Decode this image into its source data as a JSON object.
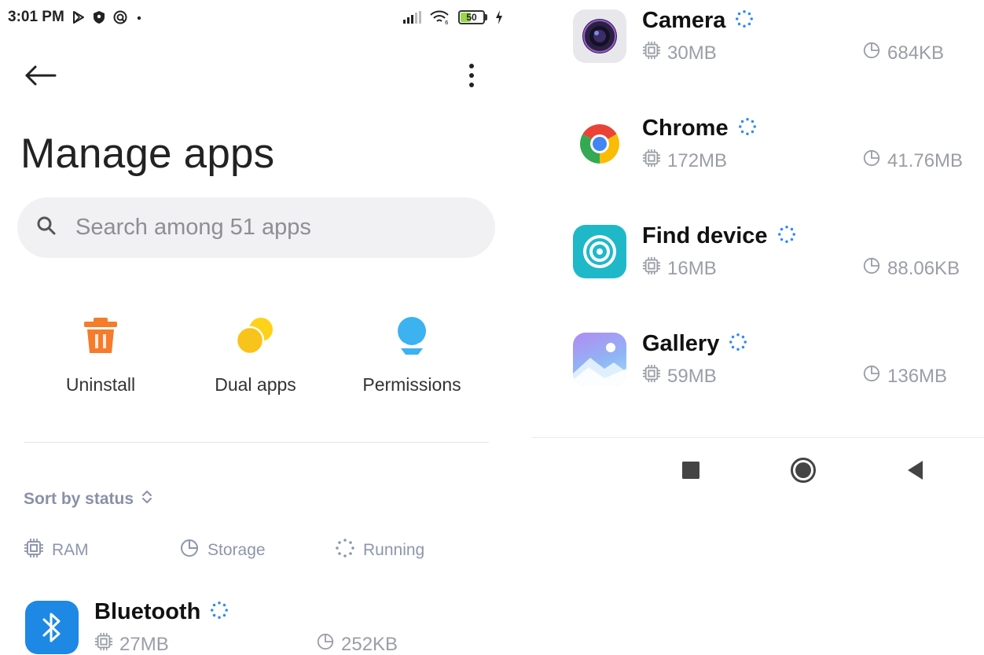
{
  "status_bar": {
    "time": "3:01 PM",
    "icons": [
      "play-store-icon",
      "shield-icon",
      "vpn-icon",
      "dot-icon"
    ],
    "right_icons": [
      "signal-icon",
      "wifi-icon",
      "charging-icon"
    ],
    "battery_level": "50",
    "battery_fraction": 0.5
  },
  "header": {
    "title": "Manage apps",
    "back_icon": "arrow-left-icon",
    "menu_icon": "more-vertical-icon"
  },
  "search": {
    "placeholder": "Search among 51 apps",
    "value": ""
  },
  "actions": [
    {
      "label": "Uninstall",
      "icon": "trash-icon",
      "color": "#F57C2B"
    },
    {
      "label": "Dual apps",
      "icon": "dual-apps-icon",
      "color": "#F8C31A"
    },
    {
      "label": "Permissions",
      "icon": "permissions-icon",
      "color": "#3CB2F0"
    }
  ],
  "sort": {
    "label": "Sort by status",
    "icon": "sort-updown-icon"
  },
  "legend": [
    {
      "label": "RAM",
      "icon": "chip-icon"
    },
    {
      "label": "Storage",
      "icon": "pie-icon"
    },
    {
      "label": "Running",
      "icon": "running-icon"
    }
  ],
  "apps_left": [
    {
      "name": "Bluetooth",
      "ram": "27MB",
      "storage": "252KB",
      "icon": "bluetooth-icon",
      "color": "#1E88E5",
      "running": true
    }
  ],
  "apps_right": [
    {
      "name": "Camera",
      "ram": "30MB",
      "storage": "684KB",
      "icon": "camera-icon",
      "color": "#E8E8EC",
      "running": true
    },
    {
      "name": "Chrome",
      "ram": "172MB",
      "storage": "41.76MB",
      "icon": "chrome-icon",
      "color": "#FFFFFF",
      "running": true
    },
    {
      "name": "Find device",
      "ram": "16MB",
      "storage": "88.06KB",
      "icon": "find-device-icon",
      "color": "#1FB8C9",
      "running": true
    },
    {
      "name": "Gallery",
      "ram": "59MB",
      "storage": "136MB",
      "icon": "gallery-icon",
      "color": "#8FB6F5",
      "running": true
    }
  ],
  "nav_bar": {
    "buttons": [
      "recents-icon",
      "home-icon",
      "back-triangle-icon"
    ]
  },
  "colors": {
    "accent_blue": "#2F8BF5",
    "muted_text": "#9A9EA6",
    "legend_text": "#8E96AD"
  }
}
